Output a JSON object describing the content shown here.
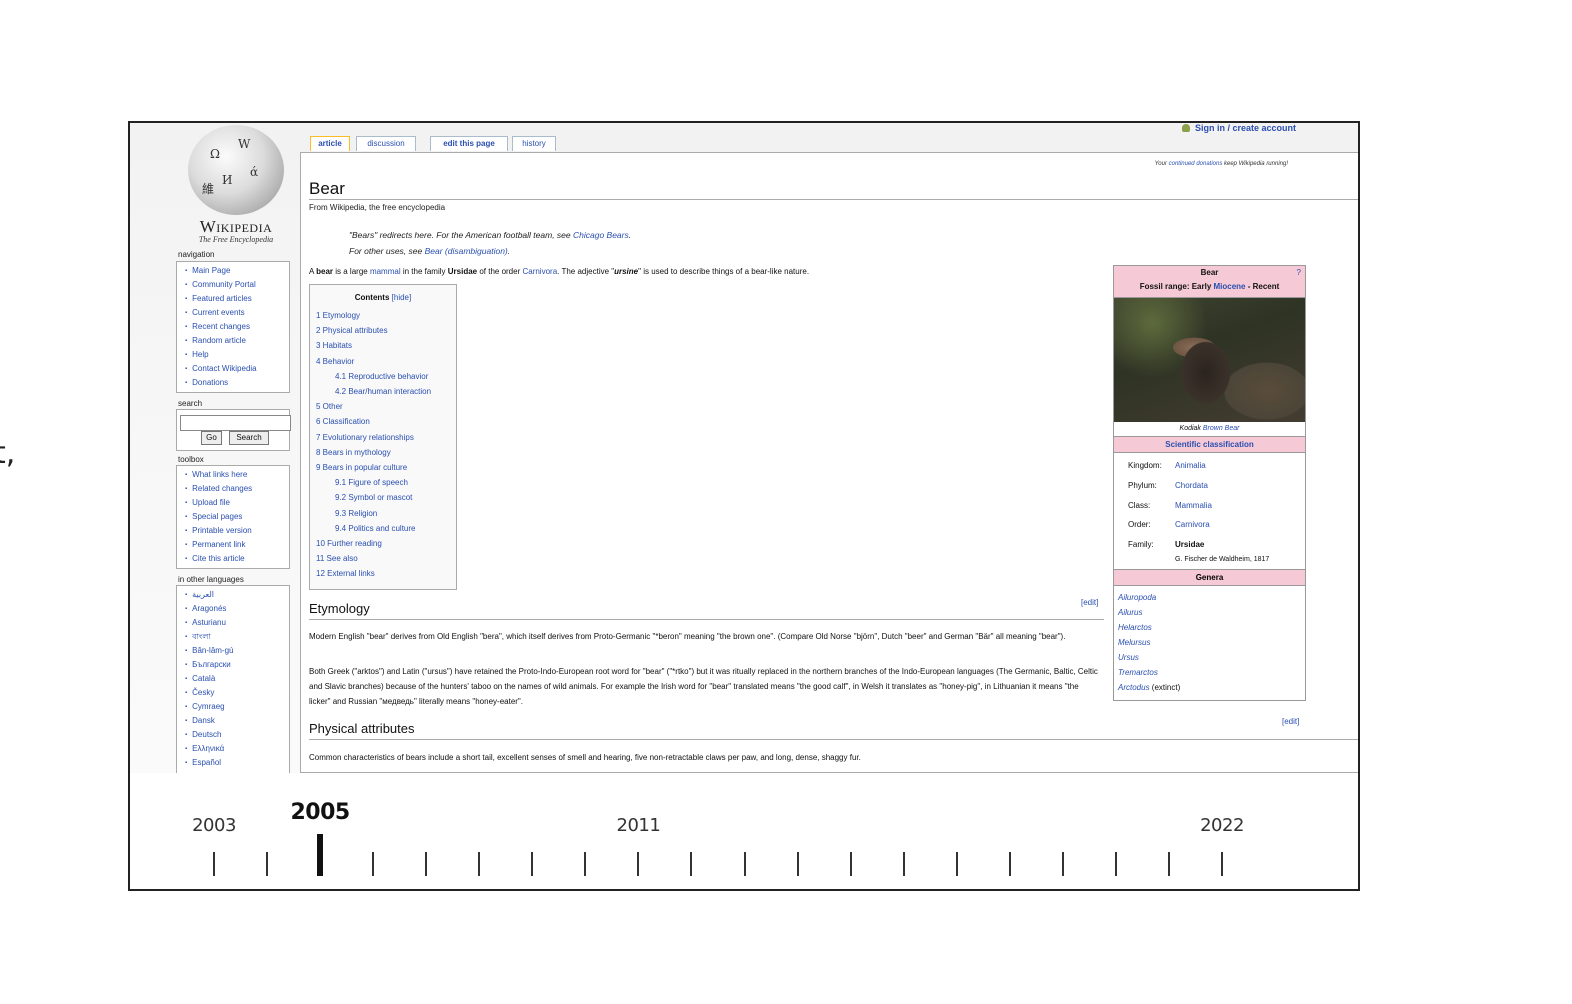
{
  "edge_text": "t,",
  "wikipedia": {
    "logo": {
      "wordmark": "Wikipedia",
      "tagline": "The Free Encyclopedia"
    },
    "user": {
      "signin_label": "Sign in / create account"
    },
    "tabs": [
      {
        "label": "article",
        "selected": true
      },
      {
        "label": "discussion",
        "selected": false
      },
      {
        "label": "edit this page",
        "selected": false
      },
      {
        "label": "history",
        "selected": false
      }
    ],
    "donation_notice": {
      "before": "Your ",
      "link": "continued donations",
      "after": " keep Wikipedia running!"
    },
    "sidebar": {
      "navigation": {
        "heading": "navigation",
        "items": [
          "Main Page",
          "Community Portal",
          "Featured articles",
          "Current events",
          "Recent changes",
          "Random article",
          "Help",
          "Contact Wikipedia",
          "Donations"
        ]
      },
      "search": {
        "heading": "search",
        "value": "",
        "go_label": "Go",
        "search_label": "Search"
      },
      "toolbox": {
        "heading": "toolbox",
        "items": [
          "What links here",
          "Related changes",
          "Upload file",
          "Special pages",
          "Printable version",
          "Permanent link",
          "Cite this article"
        ]
      },
      "languages": {
        "heading": "in other languages",
        "items": [
          "العربية",
          "Aragonés",
          "Asturianu",
          "বাংলা",
          "Bân-lâm-gú",
          "Български",
          "Català",
          "Česky",
          "Cymraeg",
          "Dansk",
          "Deutsch",
          "Ελληνικά",
          "Español"
        ]
      }
    },
    "article": {
      "title": "Bear",
      "tagline": "From Wikipedia, the free encyclopedia",
      "hatnotes": [
        {
          "text": "\"Bears\" redirects here. For the American football team, see ",
          "link": "Chicago Bears",
          "end": "."
        },
        {
          "text": "For other uses, see ",
          "link": "Bear (disambiguation)",
          "end": "."
        }
      ],
      "intro": {
        "p1": "A ",
        "b1": "bear",
        "p2": " is a large ",
        "l1": "mammal",
        "p3": " in the family ",
        "b2": "Ursidae",
        "p4": " of the order ",
        "l2": "Carnivora",
        "p5": ". The adjective \"",
        "b3": "ursine",
        "p6": "\" is used to describe things of a bear-like nature."
      },
      "toc": {
        "title": "Contents",
        "hide_label": "[hide]",
        "items": [
          {
            "label": "1 Etymology",
            "level": 1
          },
          {
            "label": "2 Physical attributes",
            "level": 1
          },
          {
            "label": "3 Habitats",
            "level": 1
          },
          {
            "label": "4 Behavior",
            "level": 1
          },
          {
            "label": "4.1 Reproductive behavior",
            "level": 2
          },
          {
            "label": "4.2 Bear/human interaction",
            "level": 2
          },
          {
            "label": "5 Other",
            "level": 1
          },
          {
            "label": "6 Classification",
            "level": 1
          },
          {
            "label": "7 Evolutionary relationships",
            "level": 1
          },
          {
            "label": "8 Bears in mythology",
            "level": 1
          },
          {
            "label": "9 Bears in popular culture",
            "level": 1
          },
          {
            "label": "9.1 Figure of speech",
            "level": 2
          },
          {
            "label": "9.2 Symbol or mascot",
            "level": 2
          },
          {
            "label": "9.3 Religion",
            "level": 2
          },
          {
            "label": "9.4 Politics and culture",
            "level": 2
          },
          {
            "label": "10 Further reading",
            "level": 1
          },
          {
            "label": "11 See also",
            "level": 1
          },
          {
            "label": "12 External links",
            "level": 1
          }
        ]
      },
      "sections": [
        {
          "heading": "Etymology",
          "edit_label": "[edit]",
          "paragraphs": [
            "Modern English \"bear\" derives from Old English \"bera\", which itself derives from Proto-Germanic \"*beron\" meaning \"the brown one\". (Compare Old Norse \"björn\", Dutch \"beer\" and German \"Bär\" all meaning \"bear\").",
            "Both Greek (\"arktos\") and Latin (\"ursus\") have retained the Proto-Indo-European root word for \"bear\" (\"*rtko\") but it was ritually replaced in the northern branches of the Indo-European languages (The Germanic, Baltic, Celtic and Slavic branches) because of the hunters' taboo on the names of wild animals. For example the Irish word for \"bear\" translated means \"the good calf\", in Welsh it translates as \"honey-pig\", in Lithuanian it means \"the licker\" and Russian \"медведь\" literally means \"honey-eater\"."
          ]
        },
        {
          "heading": "Physical attributes",
          "edit_label": "[edit]",
          "paragraphs": [
            "Common characteristics of bears include a short tail, excellent senses of smell and hearing, five non-retractable claws per paw, and long, dense, shaggy fur."
          ]
        }
      ],
      "infobox": {
        "title": "Bear",
        "help_mark": "?",
        "fossil_prefix": "Fossil range: Early ",
        "fossil_link": "Miocene",
        "fossil_suffix": " - Recent",
        "image_caption_prefix": "Kodiak ",
        "image_caption_link": "Brown Bear",
        "classification_heading": "Scientific classification",
        "taxonomy": [
          {
            "rank": "Kingdom:",
            "value": "Animalia",
            "bold": false
          },
          {
            "rank": "Phylum:",
            "value": "Chordata",
            "bold": false
          },
          {
            "rank": "Class:",
            "value": "Mammalia",
            "bold": false
          },
          {
            "rank": "Order:",
            "value": "Carnivora",
            "bold": false
          },
          {
            "rank": "Family:",
            "value": "Ursidae",
            "bold": true
          }
        ],
        "authority_link": "G. Fischer de Waldheim",
        "authority_year": ", 1817",
        "genera_heading": "Genera",
        "genera": [
          {
            "name": "Ailuropoda",
            "note": ""
          },
          {
            "name": "Ailurus",
            "note": ""
          },
          {
            "name": "Helarctos",
            "note": ""
          },
          {
            "name": "Melursus",
            "note": ""
          },
          {
            "name": "Ursus",
            "note": ""
          },
          {
            "name": "Tremarctos",
            "note": ""
          },
          {
            "name": "Arctodus",
            "note": " (extinct)"
          }
        ]
      }
    }
  },
  "timeline": {
    "selected_year": "2005",
    "start_year": 2003,
    "end_year": 2022,
    "labels": [
      "2003",
      "2005",
      "2011",
      "2022"
    ],
    "years": [
      2003,
      2004,
      2005,
      2006,
      2007,
      2008,
      2009,
      2010,
      2011,
      2012,
      2013,
      2014,
      2015,
      2016,
      2017,
      2018,
      2019,
      2020,
      2021,
      2022
    ]
  }
}
